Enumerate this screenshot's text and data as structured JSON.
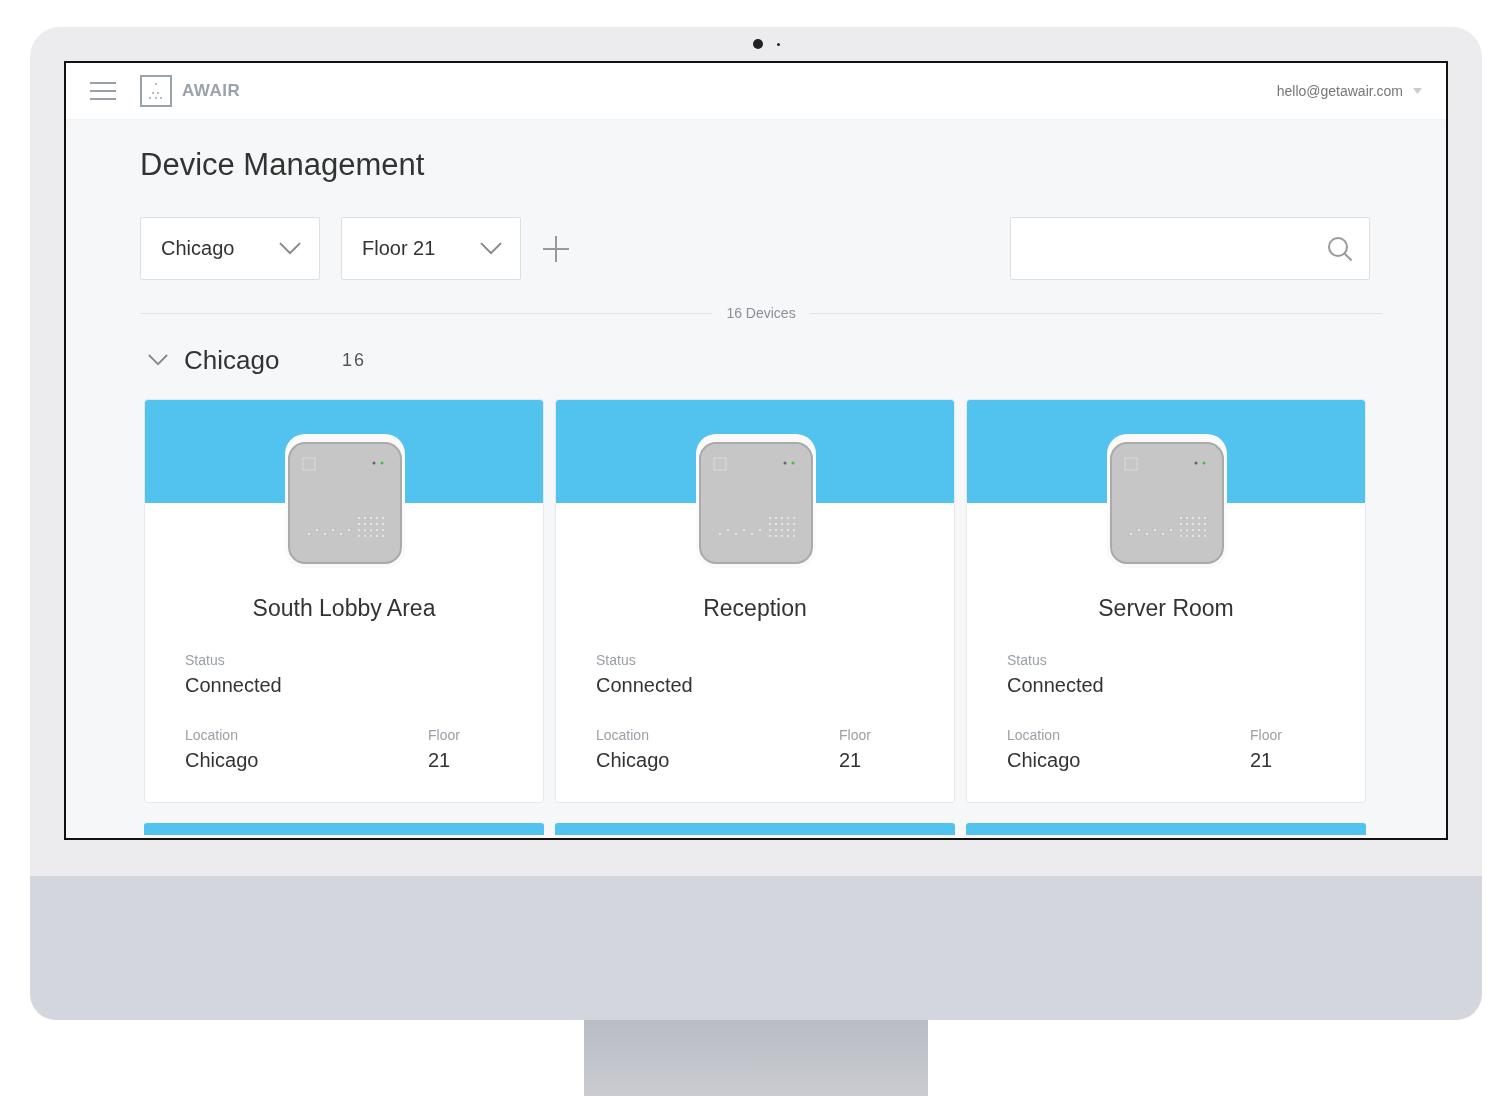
{
  "header": {
    "logo": "AWAIR",
    "account": "hello@getawair.com"
  },
  "page": {
    "title": "Device Management"
  },
  "filters": [
    {
      "value": "Chicago"
    },
    {
      "value": "Floor 21"
    }
  ],
  "device_total": "16 Devices",
  "group": {
    "name": "Chicago",
    "count": "16",
    "expanded": true
  },
  "devices": [
    {
      "name": "South Lobby Area",
      "status_label": "Status",
      "status": "Connected",
      "location_label": "Location",
      "location": "Chicago",
      "floor_label": "Floor",
      "floor": "21"
    },
    {
      "name": "Reception",
      "status_label": "Status",
      "status": "Connected",
      "location_label": "Location",
      "location": "Chicago",
      "floor_label": "Floor",
      "floor": "21"
    },
    {
      "name": "Server Room",
      "status_label": "Status",
      "status": "Connected",
      "location_label": "Location",
      "location": "Chicago",
      "floor_label": "Floor",
      "floor": "21"
    }
  ],
  "next_row": [
    {
      "kind": "card"
    },
    {
      "kind": "card"
    },
    {
      "kind": "card"
    }
  ]
}
